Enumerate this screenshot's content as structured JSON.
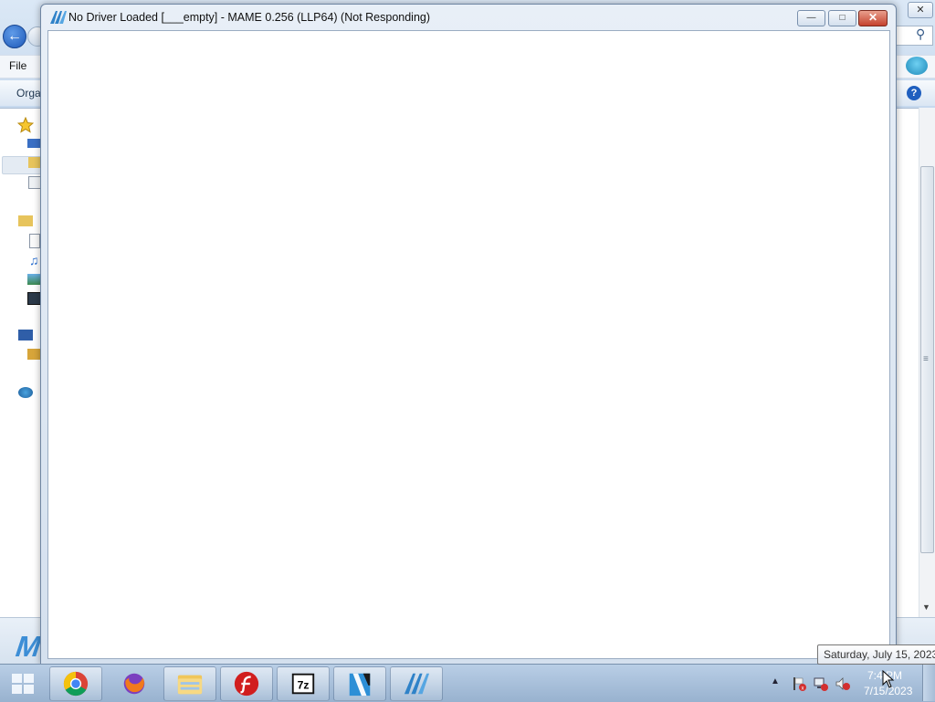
{
  "explorer": {
    "menu": {
      "file_label": "File"
    },
    "toolbar": {
      "organize_label": "Orga"
    }
  },
  "mame_window": {
    "title": "No Driver Loaded [___empty] - MAME 0.256 (LLP64) (Not Responding)",
    "icon": "mame-logo-icon",
    "controls": {
      "minimize": "minimize-icon",
      "maximize": "maximize-icon",
      "close": "close-icon"
    }
  },
  "taskbar": {
    "start_icon": "windows-logo-icon",
    "pinned": [
      {
        "name": "Google Chrome",
        "icon": "chrome-icon"
      },
      {
        "name": "Firefox",
        "icon": "firefox-icon"
      },
      {
        "name": "Windows Explorer",
        "icon": "folder-icon"
      },
      {
        "name": "Adobe Flash",
        "icon": "flash-icon"
      },
      {
        "name": "7-Zip",
        "icon": "7zip-icon"
      },
      {
        "name": "Media app",
        "icon": "clapper-icon"
      },
      {
        "name": "MAME",
        "icon": "mame-logo-icon"
      }
    ],
    "tray": {
      "time": "7:4 PM",
      "date": "7/15/2023"
    }
  },
  "tooltip": {
    "text": "Saturday, July 15, 2023"
  },
  "colors": {
    "taskbar": "#98b2cf",
    "close_button": "#c4412d",
    "chrome_red": "#db4437",
    "chrome_yellow": "#f4c20d",
    "chrome_green": "#0f9d58",
    "chrome_blue": "#4285f4"
  }
}
